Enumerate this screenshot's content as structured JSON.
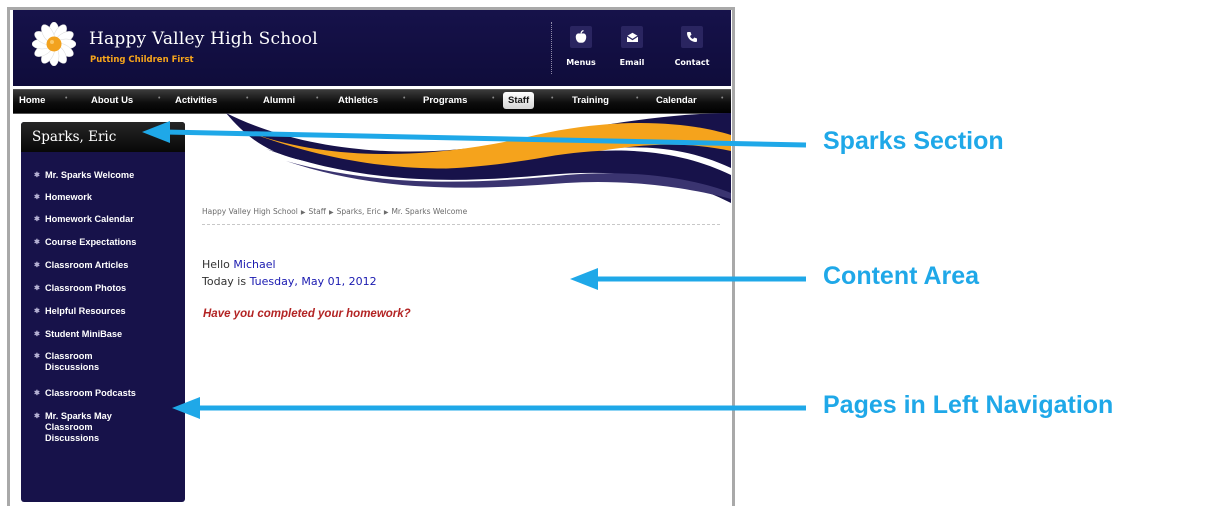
{
  "header": {
    "school_name": "Happy Valley High School",
    "tagline": "Putting Children First",
    "tools": [
      {
        "label": "Menus",
        "icon": "apple-icon"
      },
      {
        "label": "Email",
        "icon": "envelope-icon"
      },
      {
        "label": "Contact",
        "icon": "phone-icon"
      }
    ]
  },
  "nav": {
    "items": [
      "Home",
      "About Us",
      "Activities",
      "Alumni",
      "Athletics",
      "Programs",
      "Staff",
      "Training",
      "Calendar"
    ],
    "active": "Staff"
  },
  "sidebar": {
    "title": "Sparks, Eric",
    "items": [
      "Mr. Sparks Welcome",
      "Homework",
      "Homework Calendar",
      "Course Expectations",
      "Classroom Articles",
      "Classroom Photos",
      "Helpful Resources",
      "Student MiniBase",
      [
        "Classroom",
        "Discussions"
      ],
      "Classroom Podcasts",
      [
        "Mr. Sparks May",
        "Classroom",
        "Discussions"
      ]
    ]
  },
  "content": {
    "breadcrumb": [
      "Happy Valley High School",
      "Staff",
      "Sparks, Eric",
      "Mr. Sparks Welcome"
    ],
    "hello_prefix": "Hello",
    "user_name": "Michael",
    "today_prefix": "Today is",
    "date": "Tuesday, May 01, 2012",
    "question": "Have you completed your homework?"
  },
  "callouts": [
    {
      "label": "Sparks Section"
    },
    {
      "label": "Content Area"
    },
    {
      "label": "Pages in Left Navigation"
    }
  ],
  "colors": {
    "header_bg": "#16124a",
    "sidebar_bg": "#17124a",
    "tagline": "#f7a51b",
    "swoosh_orange": "#f5a31c",
    "link_blue": "#1a1ab0",
    "question_red": "#b32424",
    "callout_blue": "#1fa8e8"
  }
}
